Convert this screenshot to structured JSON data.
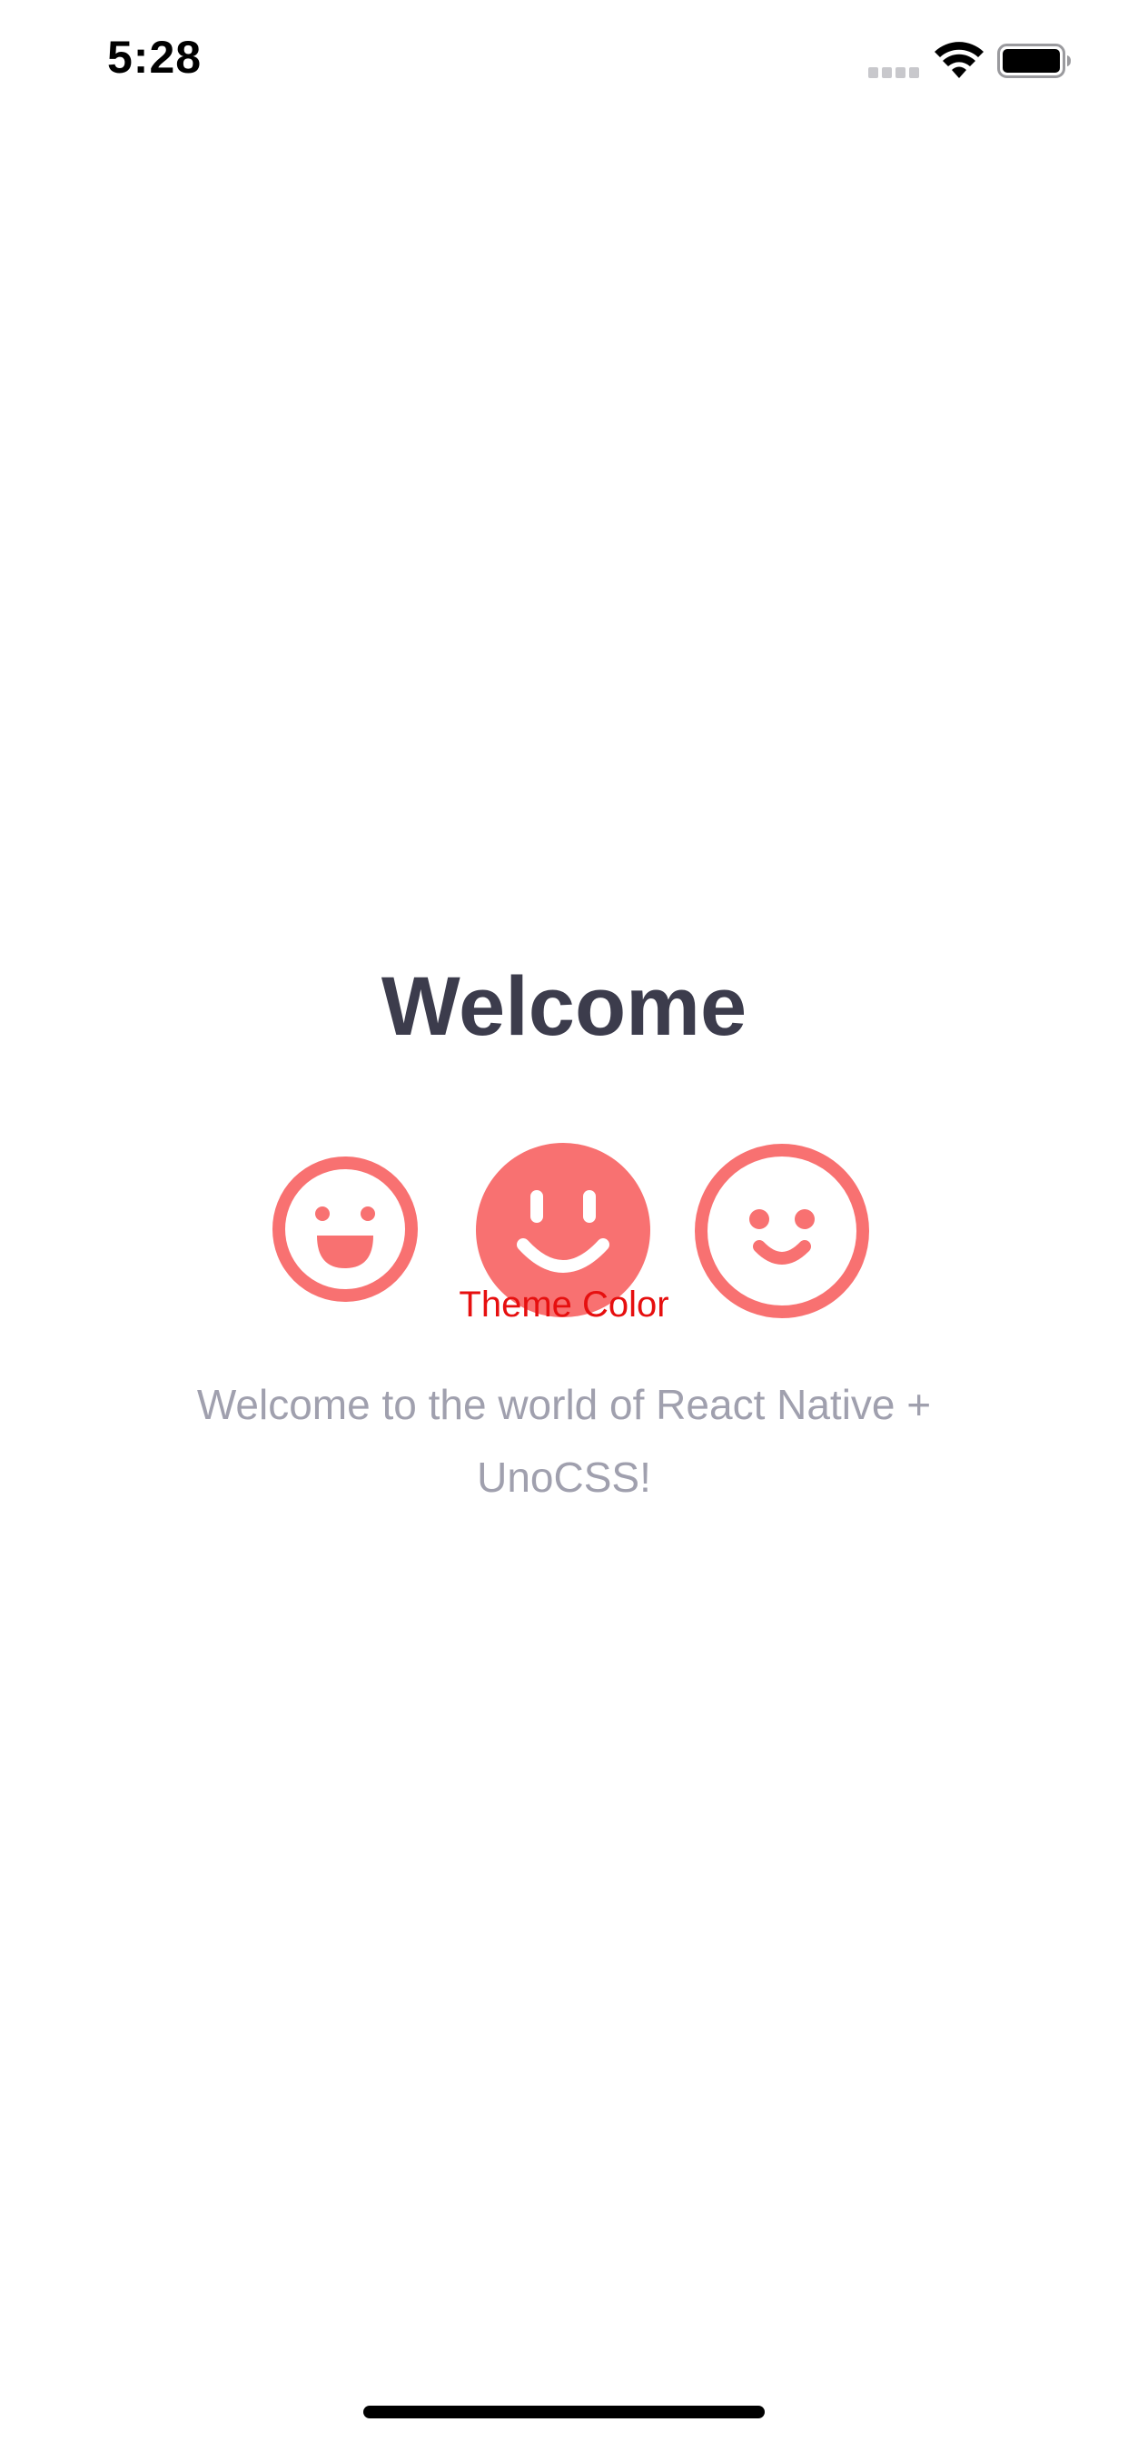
{
  "status_bar": {
    "time": "5:28",
    "icons": [
      "signal-icon",
      "wifi-icon",
      "battery-icon"
    ]
  },
  "main": {
    "title": "Welcome",
    "icons": [
      "laugh-icon",
      "smile-icon",
      "smile-beam-icon"
    ],
    "theme_label": "Theme Color",
    "subtitle": "Welcome to the world of React Native + UnoCSS!"
  },
  "colors": {
    "accent": "#f87171",
    "theme_label": "#e60f0f",
    "title": "#3c3c4c",
    "subtitle": "#a0a0ae"
  }
}
